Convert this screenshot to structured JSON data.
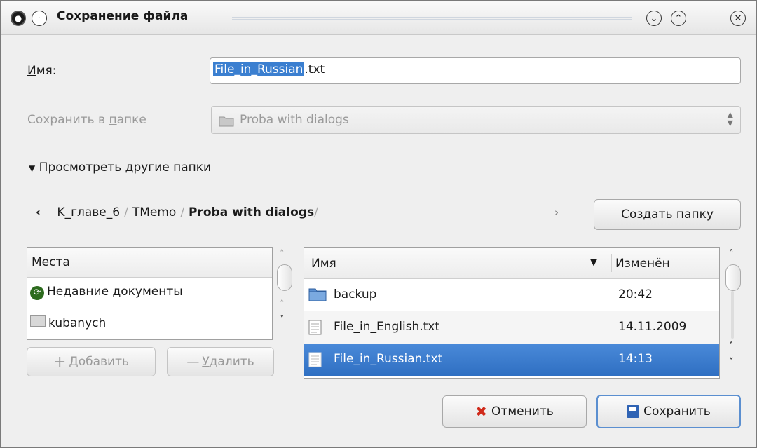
{
  "window": {
    "title": "Сохранение файла"
  },
  "name_label": {
    "before": "",
    "mnemonic": "И",
    "after": "мя:"
  },
  "filename": {
    "selected": "File_in_Russian",
    "rest": ".txt"
  },
  "save_in_label": {
    "before": "Сохранить в ",
    "mnemonic": "п",
    "after": "апке"
  },
  "save_in_value": "Proba with dialogs",
  "expander": {
    "before": "П",
    "mnemonic": "р",
    "after": "осмотреть другие папки"
  },
  "breadcrumbs": {
    "items": [
      "K_главе_6",
      "TMemo"
    ],
    "current": "Proba with dialogs",
    "trail": "/"
  },
  "new_folder_button": {
    "before": "Создать па",
    "mnemonic": "п",
    "after": "ку"
  },
  "places": {
    "header": "Места",
    "items": [
      "Недавние документы",
      "kubanych"
    ]
  },
  "add_button": {
    "mnemonic": "Д",
    "after": "обавить"
  },
  "remove_button": {
    "mnemonic": "У",
    "after": "далить"
  },
  "files": {
    "columns": {
      "name": "Имя",
      "modified": "Изменён"
    },
    "rows": [
      {
        "name": "backup",
        "modified": "20:42",
        "type": "folder"
      },
      {
        "name": "File_in_English.txt",
        "modified": "14.11.2009",
        "type": "file"
      },
      {
        "name": "File_in_Russian.txt",
        "modified": "14:13",
        "type": "file",
        "selected": true
      }
    ]
  },
  "cancel_button": {
    "before": "О",
    "mnemonic": "т",
    "after": "менить"
  },
  "save_button": {
    "before": "Со",
    "mnemonic": "х",
    "after": "ранить"
  },
  "colors": {
    "selection": "#3b7fd0",
    "cancel_icon": "#d02a1a",
    "save_icon": "#2f63b4"
  }
}
